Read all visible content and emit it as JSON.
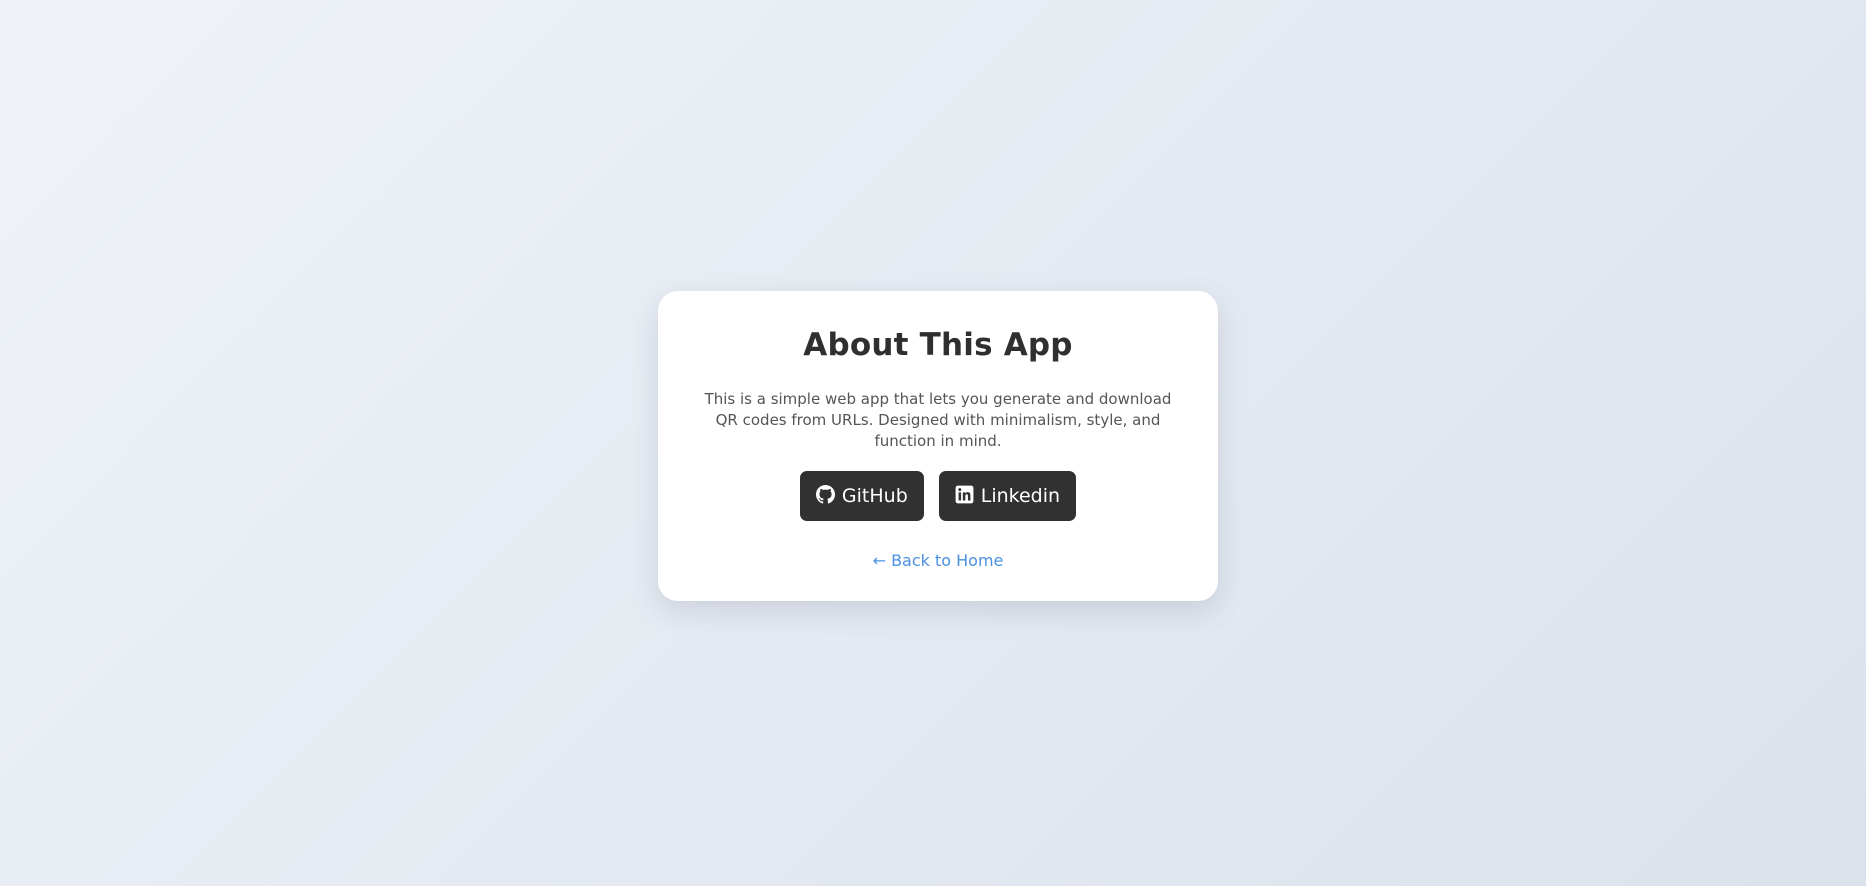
{
  "card": {
    "title": "About This App",
    "description": "This is a simple web app that lets you generate and download QR codes from URLs. Designed with minimalism, style, and function in mind.",
    "buttons": [
      {
        "label": "GitHub",
        "icon": "github-icon"
      },
      {
        "label": "Linkedin",
        "icon": "linkedin-icon"
      }
    ],
    "back_link": "← Back to Home"
  },
  "colors": {
    "button_background": "#313131",
    "link": "#4a90e2",
    "title": "#2f2f2f"
  }
}
